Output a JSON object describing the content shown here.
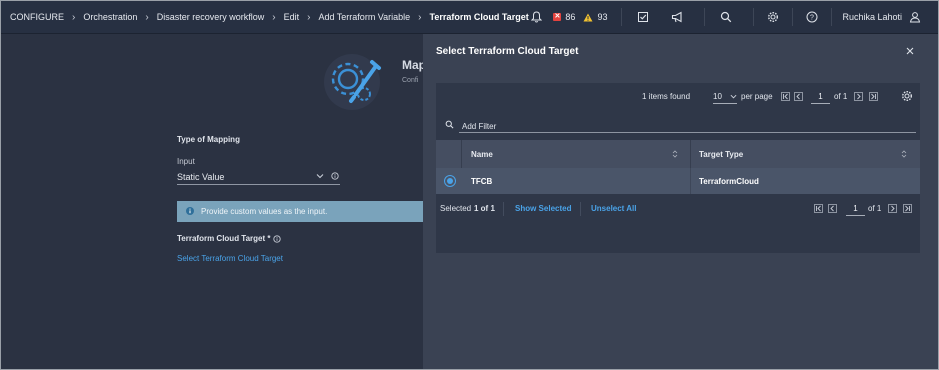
{
  "breadcrumbs": [
    "CONFIGURE",
    "Orchestration",
    "Disaster recovery workflow",
    "Edit",
    "Add Terraform Variable",
    "Terraform Cloud Target"
  ],
  "topbar": {
    "alerts_critical": "86",
    "alerts_warning": "93",
    "user_name": "Ruchika Lahoti",
    "icons": [
      "bell-icon",
      "critical-alert-icon",
      "warning-alert-icon",
      "tasks-icon",
      "megaphone-icon",
      "search-icon",
      "gear-icon",
      "help-icon",
      "user-icon"
    ]
  },
  "background_form": {
    "hero_title": "Map",
    "hero_subtitle": "Confi",
    "type_of_mapping_label": "Type of Mapping",
    "input_label": "Input",
    "input_value": "Static Value",
    "info_text": "Provide custom values as the input.",
    "target_label": "Terraform Cloud Target *",
    "select_link": "Select Terraform Cloud Target"
  },
  "panel": {
    "title": "Select Terraform Cloud Target",
    "items_found": "1 items found",
    "per_page_value": "10",
    "per_page_label": "per page",
    "page_current": "1",
    "page_of": "of 1",
    "filter_placeholder": "Add Filter",
    "columns": [
      "Name",
      "Target Type"
    ],
    "rows": [
      {
        "name": "TFCB",
        "target_type": "TerraformCloud",
        "selected": true
      }
    ],
    "footer": {
      "selected_prefix": "Selected",
      "selected_count": "1 of 1",
      "show_selected": "Show Selected",
      "unselect_all": "Unselect All",
      "page_current": "1",
      "page_of": "of 1"
    }
  },
  "colors": {
    "accent": "#4aa3e8",
    "critical": "#e5433f",
    "warning": "#f2c230",
    "panel_bg": "#3a4253",
    "page_bg": "#2b3242"
  }
}
